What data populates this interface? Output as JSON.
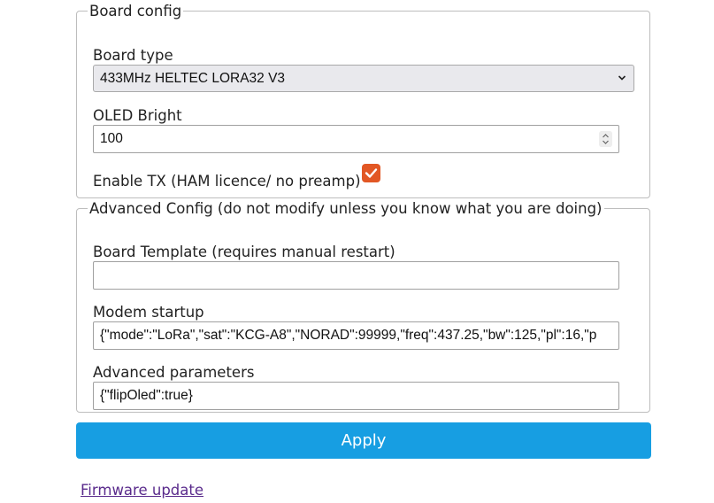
{
  "board_config": {
    "legend": "Board config",
    "board_type_label": "Board type",
    "board_type_value": "433MHz HELTEC LORA32 V3",
    "oled_label": "OLED Bright",
    "oled_value": "100",
    "enable_tx_label": "Enable TX (HAM licence/ no preamp)",
    "enable_tx_checked": true
  },
  "advanced_config": {
    "legend": "Advanced Config (do not modify unless you know what you are doing)",
    "board_template_label": "Board Template (requires manual restart)",
    "board_template_value": "",
    "modem_startup_label": "Modem startup",
    "modem_startup_value": "{\"mode\":\"LoRa\",\"sat\":\"KCG-A8\",\"NORAD\":99999,\"freq\":437.25,\"bw\":125,\"pl\":16,\"p",
    "advanced_params_label": "Advanced parameters",
    "advanced_params_value": "{\"flipOled\":true}"
  },
  "apply_label": "Apply",
  "firmware_link": "Firmware update",
  "colors": {
    "accent_button": "#179ee2",
    "checkbox": "#e25724",
    "link": "#5a2b8c"
  }
}
